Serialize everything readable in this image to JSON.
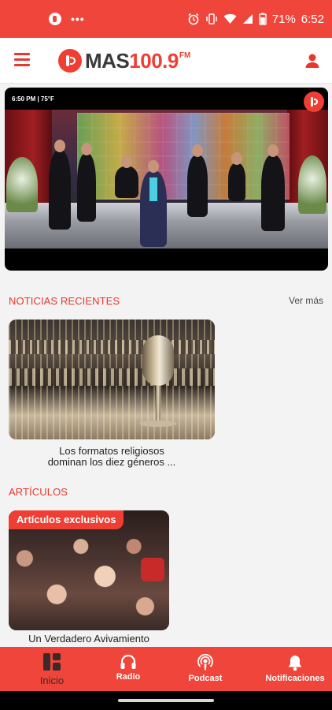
{
  "status_bar": {
    "battery_percent": "71%",
    "time": "6:52",
    "dots": "•••"
  },
  "header": {
    "logo_mas": "MAS",
    "logo_number": "100.9",
    "logo_fm": "FM"
  },
  "video": {
    "overlay_time": "6:50 PM | 75°F"
  },
  "news": {
    "section_title": "NOTICIAS RECIENTES",
    "see_more": "Ver más",
    "items": [
      {
        "caption_line1": "Los formatos religiosos",
        "caption_line2": "dominan los diez géneros ..."
      }
    ]
  },
  "articles": {
    "section_title": "ARTÍCULOS",
    "items": [
      {
        "badge": "Artículos exclusivos",
        "caption": "Un Verdadero Avivamiento"
      }
    ]
  },
  "bottom_nav": {
    "items": [
      {
        "label": "Inicio",
        "icon": "home-icon",
        "active": true
      },
      {
        "label": "Radio",
        "icon": "headphones-icon"
      },
      {
        "label": "Podcast",
        "icon": "podcast-icon"
      },
      {
        "label": "Notificaciones",
        "icon": "bell-icon"
      }
    ]
  },
  "colors": {
    "brand_red": "#ef3e33",
    "status_bar": "#f0453a"
  }
}
